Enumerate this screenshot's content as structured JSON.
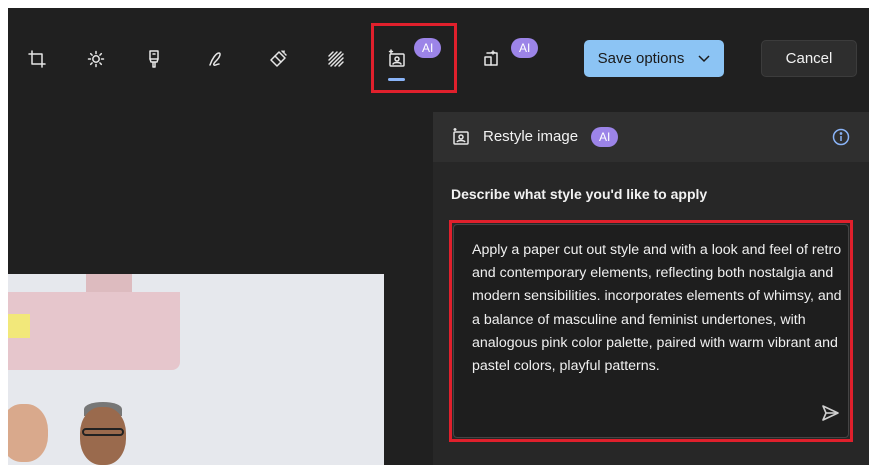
{
  "toolbar": {
    "tools": [
      {
        "name": "crop-icon"
      },
      {
        "name": "brightness-icon"
      },
      {
        "name": "filter-icon"
      },
      {
        "name": "markup-icon"
      },
      {
        "name": "erase-icon"
      },
      {
        "name": "background-blur-icon"
      },
      {
        "name": "restyle-image-icon"
      },
      {
        "name": "generative-fill-icon"
      }
    ],
    "ai_badge": "AI",
    "save_label": "Save options",
    "cancel_label": "Cancel"
  },
  "panel": {
    "title": "Restyle image",
    "ai_badge": "AI",
    "describe_label": "Describe what style you'd like to apply",
    "prompt_text": "Apply a paper cut out style and with a look and feel of retro and contemporary elements, reflecting both nostalgia and modern sensibilities. incorporates elements of whimsy, and a balance of masculine and feminist undertones, with analogous pink color palette, paired with warm vibrant and pastel colors, playful patterns."
  },
  "colors": {
    "background": "#202020",
    "accent": "#8cc4f4",
    "ai_badge": "#9c84e8",
    "highlight": "#e0202c"
  }
}
